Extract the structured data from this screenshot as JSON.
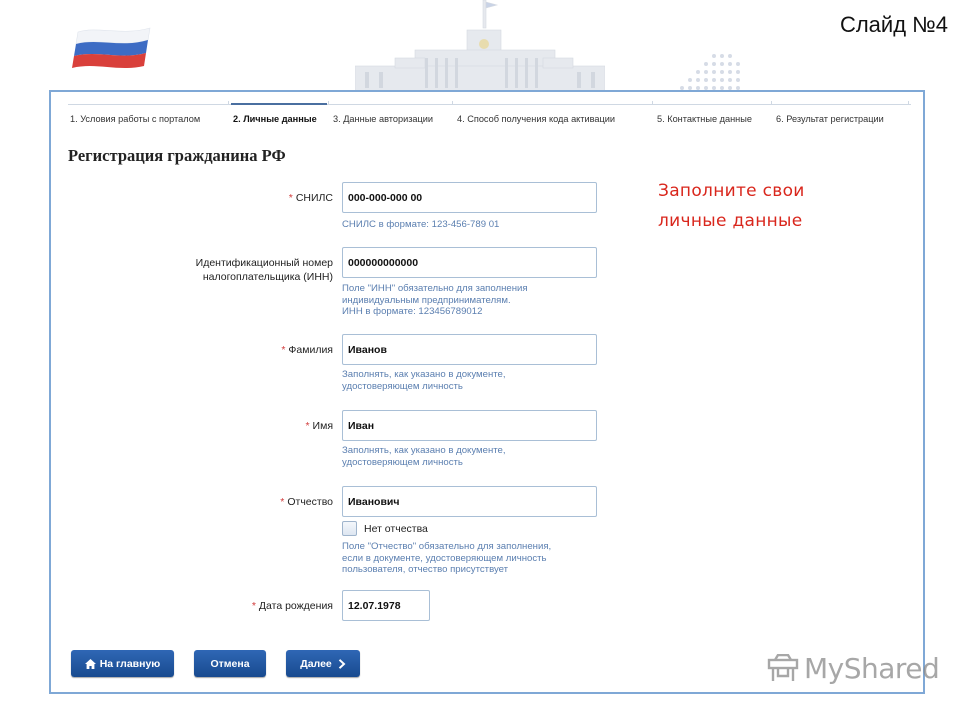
{
  "slide": {
    "number_label": "Слайд №4"
  },
  "steps": [
    {
      "label": "1. Условия работы с порталом",
      "active": false
    },
    {
      "label": "2. Личные данные",
      "active": true
    },
    {
      "label": "3. Данные авторизации",
      "active": false
    },
    {
      "label": "4. Способ получения кода активации",
      "active": false
    },
    {
      "label": "5. Контактные данные",
      "active": false
    },
    {
      "label": "6. Результат регистрации",
      "active": false
    }
  ],
  "form": {
    "title": "Регистрация гражданина РФ",
    "required_mark": "*",
    "snils": {
      "label": "СНИЛС",
      "value": "000-000-000 00",
      "hint": "СНИЛС в формате: 123-456-789 01"
    },
    "inn": {
      "label_line1": "Идентификационный номер",
      "label_line2": "налогоплательщика (ИНН)",
      "value": "000000000000",
      "hint_line1": "Поле \"ИНН\" обязательно для заполнения",
      "hint_line2": "индивидуальным предпринимателям.",
      "hint_line3": "ИНН в формате: 123456789012"
    },
    "surname": {
      "label": "Фамилия",
      "value": "Иванов",
      "hint_line1": "Заполнять, как указано в документе,",
      "hint_line2": "удостоверяющем личность"
    },
    "name": {
      "label": "Имя",
      "value": "Иван",
      "hint_line1": "Заполнять, как указано в документе,",
      "hint_line2": "удостоверяющем личность"
    },
    "patronymic": {
      "label": "Отчество",
      "value": "Иванович",
      "no_patronymic_label": "Нет отчества",
      "no_patronymic_checked": false,
      "hint_line1": "Поле \"Отчество\" обязательно для заполнения,",
      "hint_line2": "если в документе, удостоверяющем личность",
      "hint_line3": "пользователя, отчество присутствует"
    },
    "birth_date": {
      "label": "Дата рождения",
      "value": "12.07.1978"
    }
  },
  "buttons": {
    "home": "На главную",
    "cancel": "Отмена",
    "next": "Далее"
  },
  "annotation": {
    "line1": "Заполните свои",
    "line2": "личные данные"
  },
  "watermark": {
    "text": "MyShared"
  },
  "colors": {
    "button": "#245aa3",
    "hint": "#5b7fb0",
    "required": "#d13b3b",
    "annotation": "#d9261c",
    "active_step": "#4a6fa0"
  },
  "icons": {
    "home_button": "home-icon",
    "next_button": "chevron-right-icon"
  }
}
